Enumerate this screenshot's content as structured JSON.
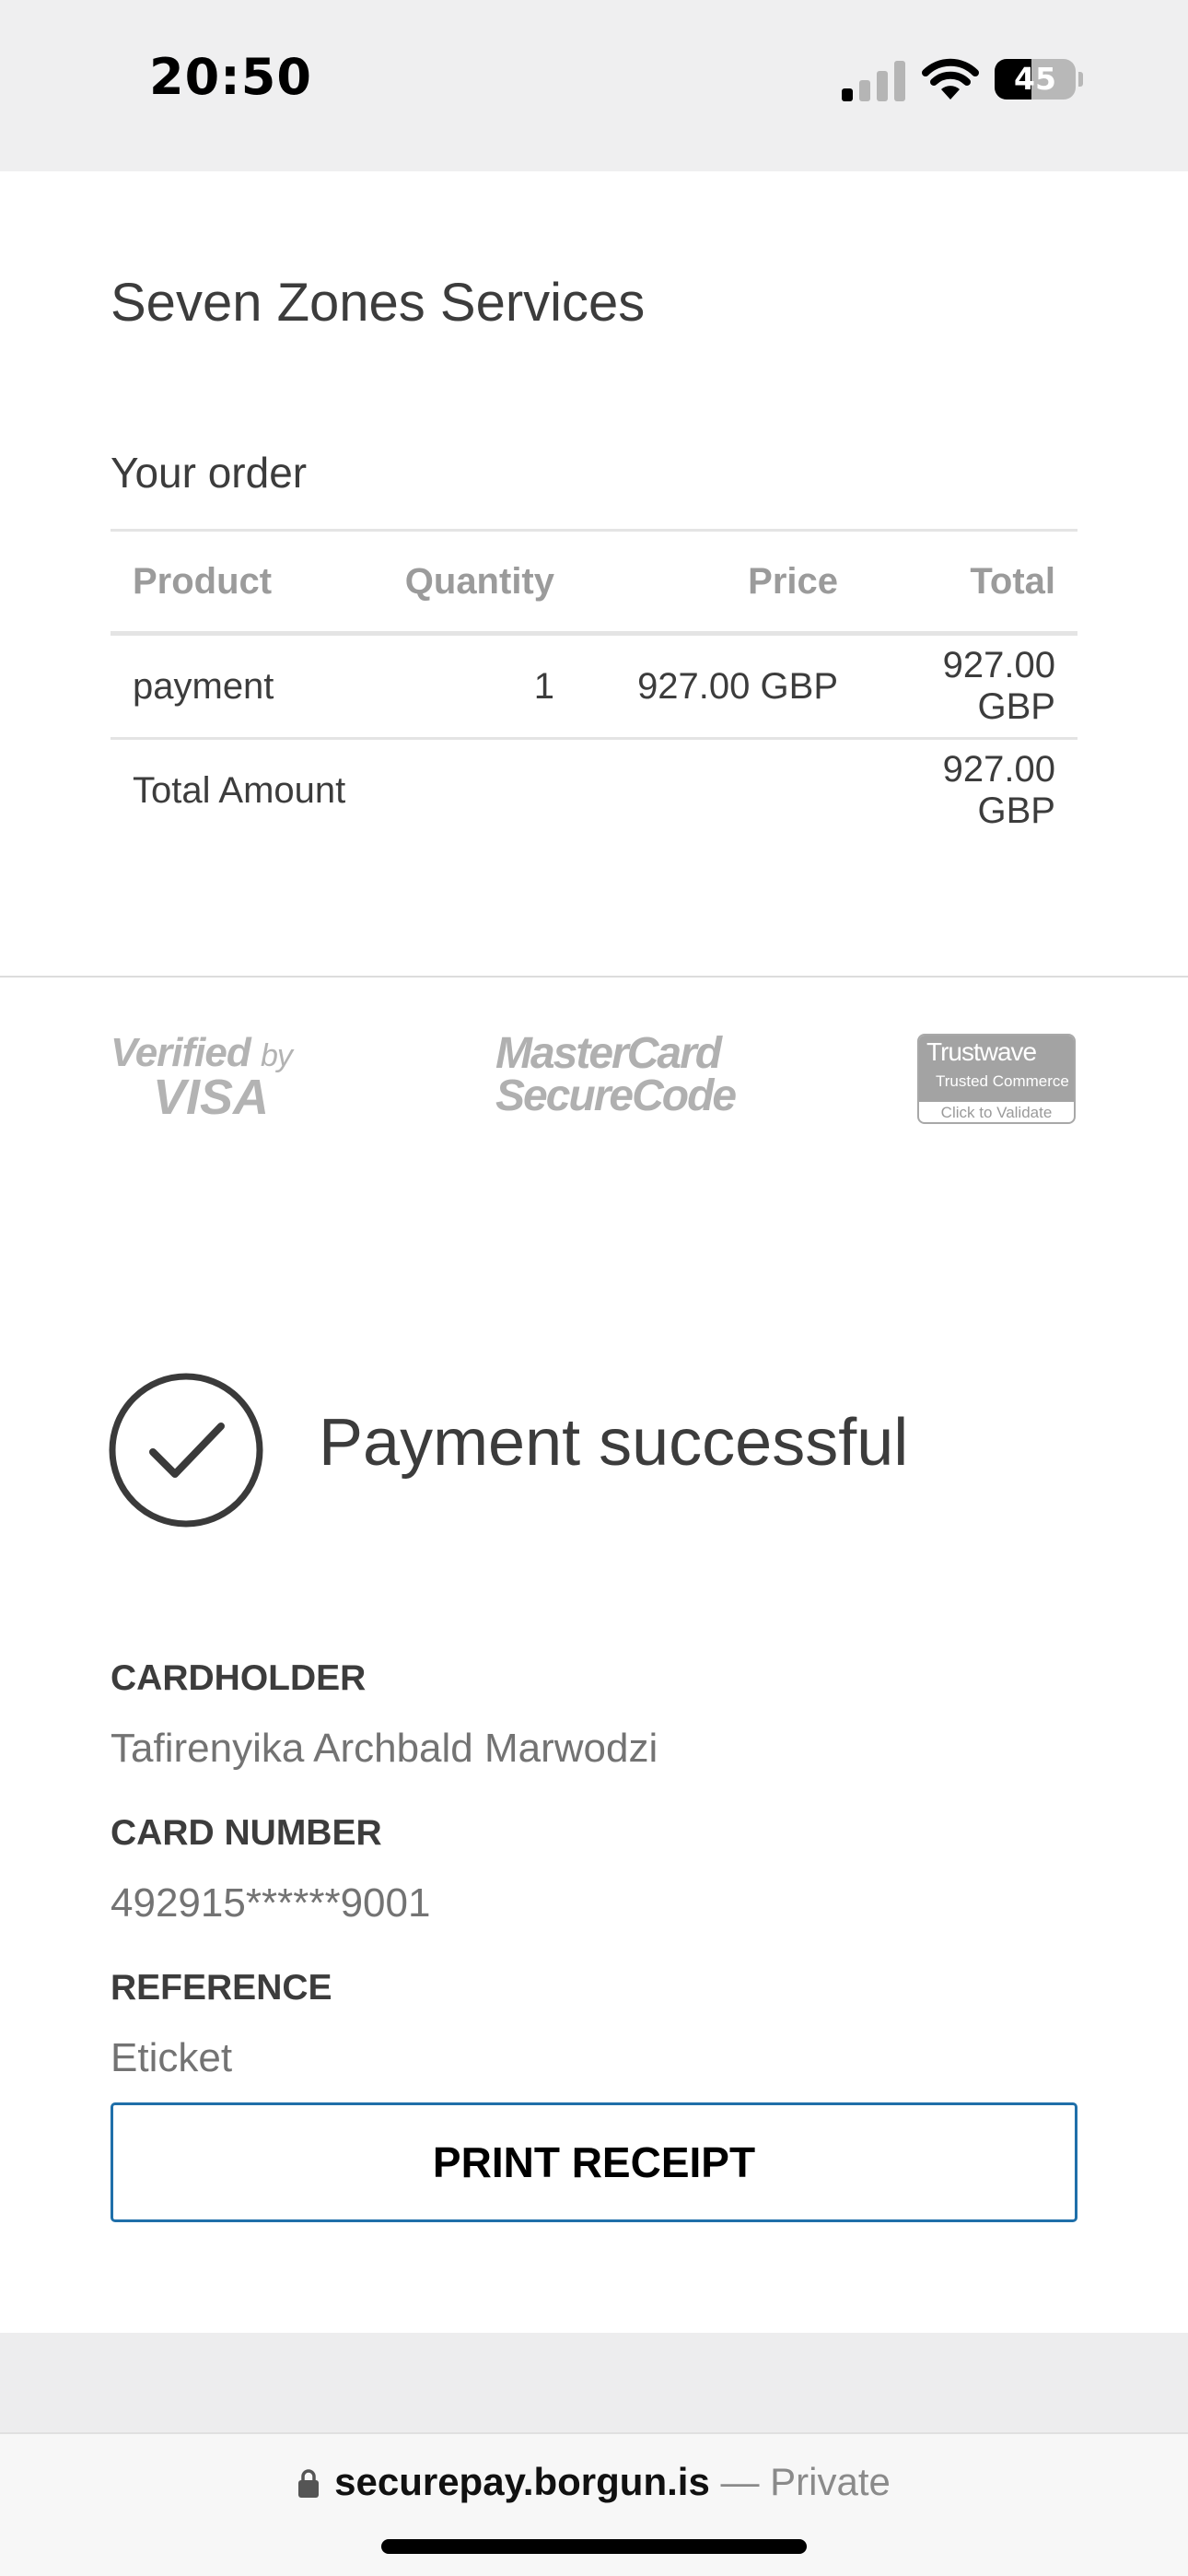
{
  "status_bar": {
    "time": "20:50",
    "battery_level": "45",
    "battery_fraction": 0.45,
    "signal_bars_active": 1,
    "signal_bars_total": 4
  },
  "merchant": {
    "name": "Seven Zones Services"
  },
  "order": {
    "heading": "Your order",
    "columns": {
      "product": "Product",
      "quantity": "Quantity",
      "price": "Price",
      "total": "Total"
    },
    "items": [
      {
        "product": "payment",
        "quantity": "1",
        "price": "927.00 GBP",
        "total": "927.00 GBP"
      }
    ],
    "total_label": "Total Amount",
    "total_amount": "927.00 GBP"
  },
  "security_logos": {
    "visa": {
      "verified": "Verified",
      "by": "by",
      "brand": "VISA"
    },
    "mastercard": {
      "line1": "MasterCard",
      "line2": "SecureCode"
    },
    "trustwave": {
      "name": "Trustwave",
      "subtitle": "Trusted Commerce",
      "action": "Click to Validate"
    }
  },
  "result": {
    "title": "Payment successful",
    "icon": "check-circle-icon"
  },
  "details": {
    "cardholder_label": "CARDHOLDER",
    "cardholder_value": "Tafirenyika Archbald Marwodzi",
    "card_number_label": "CARD NUMBER",
    "card_number_value": "492915******9001",
    "reference_label": "REFERENCE",
    "reference_value": "Eticket"
  },
  "actions": {
    "print_receipt": "PRINT RECEIPT"
  },
  "browser": {
    "domain": "securepay.borgun.is",
    "separator": "—",
    "mode": "Private",
    "lock_icon": "lock-icon"
  },
  "colors": {
    "button_border": "#1f6fa9",
    "text_primary": "#3c3c3c",
    "text_muted": "#737373",
    "header_muted": "#9b9b9b"
  }
}
